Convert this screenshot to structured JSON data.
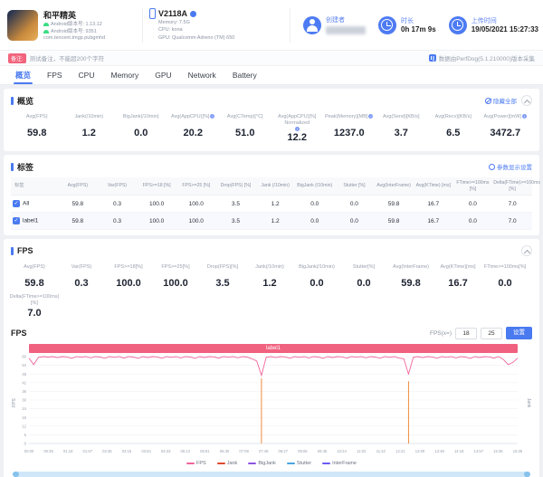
{
  "header": {
    "app": {
      "name": "和平精英",
      "version_line1": "Android版本号: 1.13.12",
      "version_line2": "Android版本号: 9351",
      "package": "com.tencent.tmgp.pubgmhd"
    },
    "device": {
      "model": "V2118A",
      "memory": "Memory: 7.5G",
      "cpu": "CPU: kona",
      "gpu": "GPU: Qualcomm Adreno (TM) 650"
    },
    "creator": {
      "label": "创建者"
    },
    "duration": {
      "label": "时长",
      "value": "0h 17m 9s"
    },
    "upload": {
      "label": "上传时间",
      "value": "19/05/2021 15:27:33"
    }
  },
  "notes": {
    "badge": "备注:",
    "text": "测试备注，不能超200个字符",
    "collector": "数据由PerfDog(5.1.210000)版本采集"
  },
  "tabs": [
    {
      "label": "概览",
      "active": true
    },
    {
      "label": "FPS",
      "active": false
    },
    {
      "label": "CPU",
      "active": false
    },
    {
      "label": "Memory",
      "active": false
    },
    {
      "label": "GPU",
      "active": false
    },
    {
      "label": "Network",
      "active": false
    },
    {
      "label": "Battery",
      "active": false
    }
  ],
  "overview": {
    "title": "概览",
    "hide_all": "隐藏全部",
    "stats": [
      {
        "label": "Avg(FPS)",
        "value": "59.8"
      },
      {
        "label": "Jank(/10min)",
        "value": "1.2"
      },
      {
        "label": "BigJank(/10min)",
        "value": "0.0"
      },
      {
        "label": "Avg(AppCPU)[%]",
        "value": "20.2",
        "info": true
      },
      {
        "label": "Avg(CTemp)[°C]",
        "value": "51.0"
      },
      {
        "label": "Avg(AppCPU)[%] Normalized",
        "value": "12.2",
        "info": true
      },
      {
        "label": "Peak(Memory)[MB]",
        "value": "1237.0",
        "info": true
      },
      {
        "label": "Avg(Send)[KB/s]",
        "value": "3.7"
      },
      {
        "label": "Avg(Recv)[KB/s]",
        "value": "6.5"
      },
      {
        "label": "Avg(Power)[mW]",
        "value": "3472.7",
        "info": true
      }
    ]
  },
  "labels_section": {
    "title": "标签",
    "settings_link": "参数显示设置",
    "table": {
      "columns": [
        "标签",
        "Avg(FPS)",
        "Var(FPS)",
        "FPS>=18 [%]",
        "FPS>=25 [%]",
        "Drop(FPS) [%]",
        "Jank (/10min)",
        "BigJank (/10min)",
        "Stutter [%]",
        "Avg(InterFrame)",
        "Avg(KTime) [ms]",
        "FTime>=100ms [%]",
        "Delta(FTime)>=100ms [%]"
      ],
      "rows": [
        {
          "label": "All",
          "checked": true,
          "values": [
            "59.8",
            "0.3",
            "100.0",
            "100.0",
            "3.5",
            "1.2",
            "0.0",
            "0.0",
            "59.8",
            "16.7",
            "0.0",
            "7.0"
          ]
        },
        {
          "label": "label1",
          "checked": true,
          "values": [
            "59.8",
            "0.3",
            "100.0",
            "100.0",
            "3.5",
            "1.2",
            "0.0",
            "0.0",
            "59.8",
            "16.7",
            "0.0",
            "7.0"
          ]
        }
      ]
    }
  },
  "fps_section": {
    "title": "FPS",
    "stats": [
      {
        "label": "Avg(FPS)",
        "value": "59.8"
      },
      {
        "label": "Var(FPS)",
        "value": "0.3"
      },
      {
        "label": "FPS>=18[%]",
        "value": "100.0"
      },
      {
        "label": "FPS>=25[%]",
        "value": "100.0"
      },
      {
        "label": "Drop(FPS)[%]",
        "value": "3.5"
      },
      {
        "label": "Jank(/10min)",
        "value": "1.2"
      },
      {
        "label": "BigJank(/10min)",
        "value": "0.0"
      },
      {
        "label": "Stutter[%]",
        "value": "0.0"
      },
      {
        "label": "Avg(InterFrame)",
        "value": "59.8"
      },
      {
        "label": "Avg(KTime)[ms]",
        "value": "16.7"
      },
      {
        "label": "FTime>=100ms[%]",
        "value": "0.0"
      },
      {
        "label": "Delta(FTime>=100ms)[%]",
        "value": "7.0"
      }
    ],
    "controls": {
      "fps_x_label": "FPS(x=)",
      "input1": "18",
      "input2": "25",
      "apply": "设置"
    }
  },
  "chart_data": {
    "type": "line",
    "title": "FPS",
    "ylabel_left": "FPS",
    "ylabel_right": "Jank",
    "ylim": [
      0,
      60
    ],
    "y_tick_step": 6,
    "x_labels": [
      "00:00",
      "00:39",
      "01:18",
      "01:57",
      "02:36",
      "03:15",
      "03:54",
      "04:33",
      "05:12",
      "05:51",
      "06:30",
      "07:09",
      "07:48",
      "08:27",
      "09:06",
      "09:45",
      "10:24",
      "11:03",
      "11:42",
      "12:21",
      "13:00",
      "13:39",
      "14:18",
      "14:57",
      "15:36",
      "16:28"
    ],
    "series": [
      {
        "name": "FPS",
        "color": "#f0649b",
        "values": [
          59,
          54.5,
          59.5,
          60,
          59.7,
          60,
          59.3,
          60,
          59.8,
          58.8,
          60,
          59.6,
          60,
          59.2,
          60,
          59.7,
          58.9,
          60,
          59.5,
          60,
          59,
          60,
          59.7,
          58.8,
          60,
          59.4,
          60,
          59.8,
          58.9,
          60,
          59.5,
          60,
          59.1,
          60,
          59.7,
          58.8,
          60,
          59.4,
          60,
          59.8,
          59,
          60,
          59.6,
          60,
          59.2,
          60,
          59.7,
          58.5,
          57,
          47,
          59.5,
          60,
          59.3,
          60,
          59.8,
          58.9,
          60,
          59.5,
          60,
          59.1,
          60,
          59.7,
          58.8,
          60,
          59.4,
          60,
          59.8,
          59,
          60,
          59.6,
          60,
          59.2,
          60,
          59.7,
          58.9,
          60,
          59.5,
          60,
          59,
          58.5,
          48,
          59.5,
          60,
          59.3,
          60,
          59.8,
          58.9,
          60,
          59.5,
          60,
          59.1,
          60,
          59.7,
          58.8,
          60,
          59.4,
          60,
          59.8,
          59,
          60,
          58,
          54.5,
          56,
          59
        ]
      }
    ],
    "spikes": [
      {
        "index": 49,
        "value": 45,
        "color": "#f08a3c"
      },
      {
        "index": 80,
        "value": 43,
        "color": "#f08a3c"
      }
    ],
    "legend": [
      {
        "label": "FPS",
        "color": "#f0649b"
      },
      {
        "label": "Jank",
        "color": "#e0492e"
      },
      {
        "label": "BigJank",
        "color": "#8c54e0"
      },
      {
        "label": "Stutter",
        "color": "#4aa3e0"
      },
      {
        "label": "InterFrame",
        "color": "#6a5af0"
      }
    ],
    "banner_label": "label1",
    "banner_color": "#f0617f"
  }
}
